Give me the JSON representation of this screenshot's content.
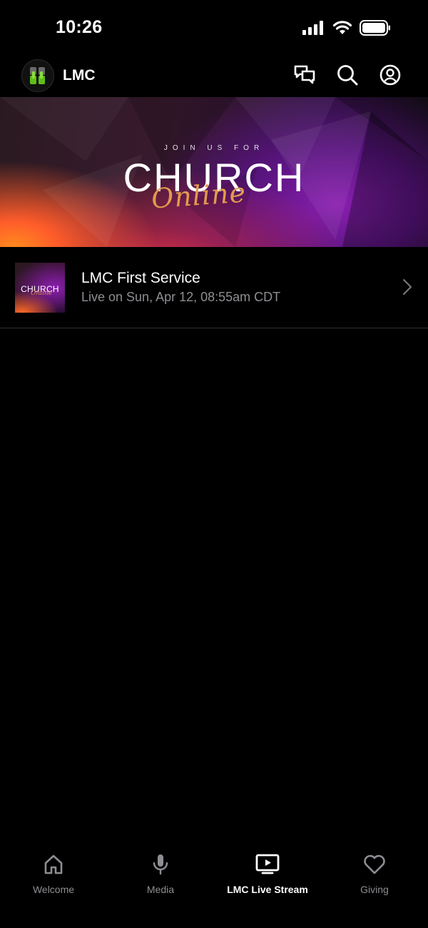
{
  "status_bar": {
    "time": "10:26"
  },
  "header": {
    "app_name": "LMC"
  },
  "banner": {
    "kicker": "JOIN US FOR",
    "title": "CHURCH",
    "script": "Online"
  },
  "list": {
    "items": [
      {
        "thumb_title": "CHURCH",
        "thumb_script": "Online",
        "title": "LMC First Service",
        "subtitle": "Live on Sun, Apr 12, 08:55am CDT"
      }
    ]
  },
  "tabs": [
    {
      "label": "Welcome",
      "icon": "home-icon",
      "active": false
    },
    {
      "label": "Media",
      "icon": "microphone-icon",
      "active": false
    },
    {
      "label": "LMC Live Stream",
      "icon": "tv-play-icon",
      "active": true
    },
    {
      "label": "Giving",
      "icon": "heart-icon",
      "active": false
    }
  ],
  "colors": {
    "background": "#000000",
    "inactive_tab": "#8e8e93",
    "subtitle": "#8e8e93",
    "script_accent": "#e39a4e",
    "logo_green": "#5fbf1a"
  }
}
